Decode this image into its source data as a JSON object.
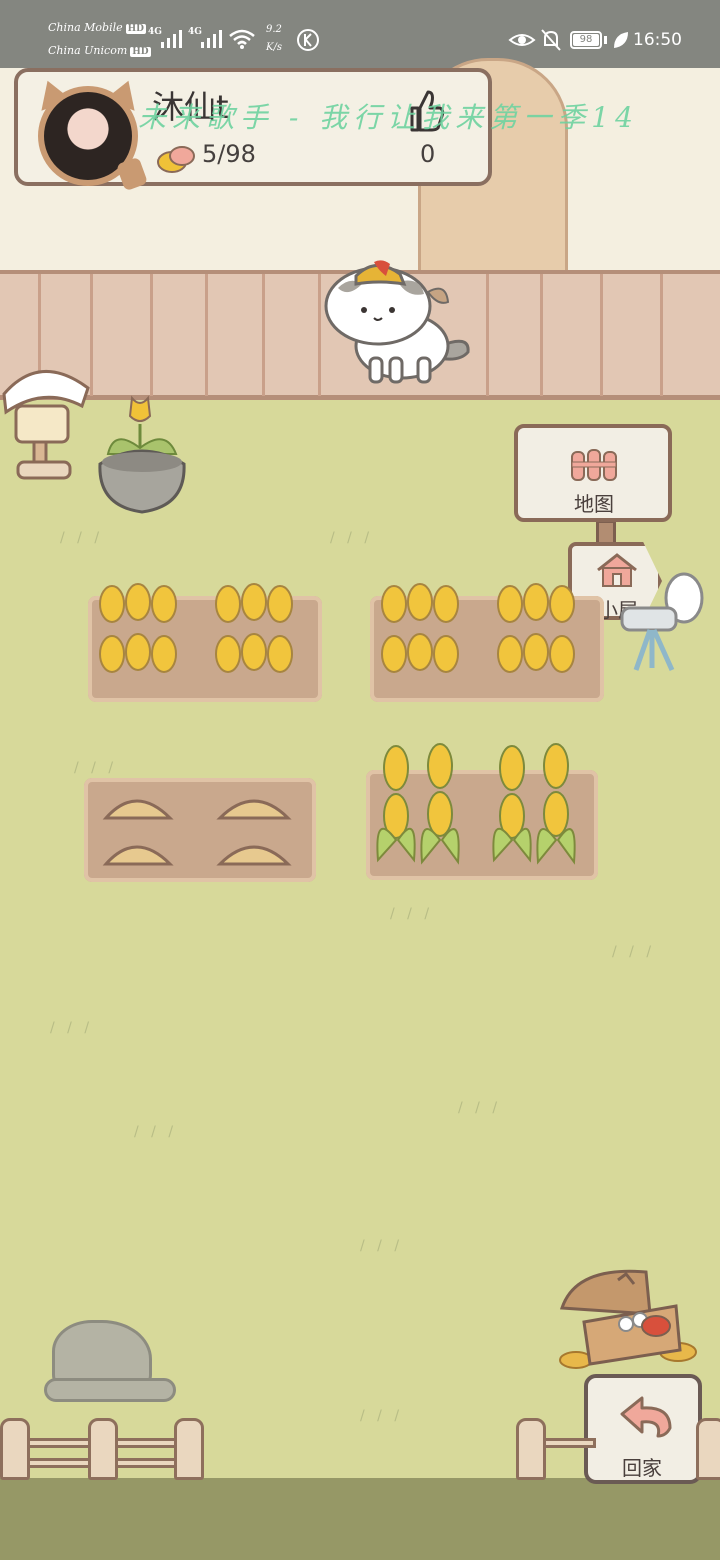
{
  "status_bar": {
    "carrier1": "China Mobile",
    "carrier2": "China Unicom",
    "hd1": "HD",
    "hd2": "HD",
    "net1": "4G",
    "net2": "4G",
    "speed_value": "9.2",
    "speed_unit": "K/s",
    "battery": "98",
    "time": "16:50"
  },
  "profile": {
    "name": "沐仙t",
    "coins": "5/98",
    "likes": "0"
  },
  "watermark": "未来歌手 - 我行让我来第一季14",
  "map_sign": {
    "label": "地图"
  },
  "house_sign": {
    "label": "小屋"
  },
  "home_button": {
    "label": "回家"
  },
  "colors": {
    "status_bar": "#848680",
    "ground": "#d7d99a",
    "wood_border": "#8a6a58",
    "accent_pink": "#f0a89b",
    "watermark": "#6fd3a0"
  },
  "icons": [
    "coin-bread-icon",
    "thumb-up-icon",
    "fence-map-icon",
    "house-icon",
    "return-arrow-icon",
    "eye-icon",
    "bell-off-icon",
    "leaf-icon",
    "wifi-icon"
  ]
}
